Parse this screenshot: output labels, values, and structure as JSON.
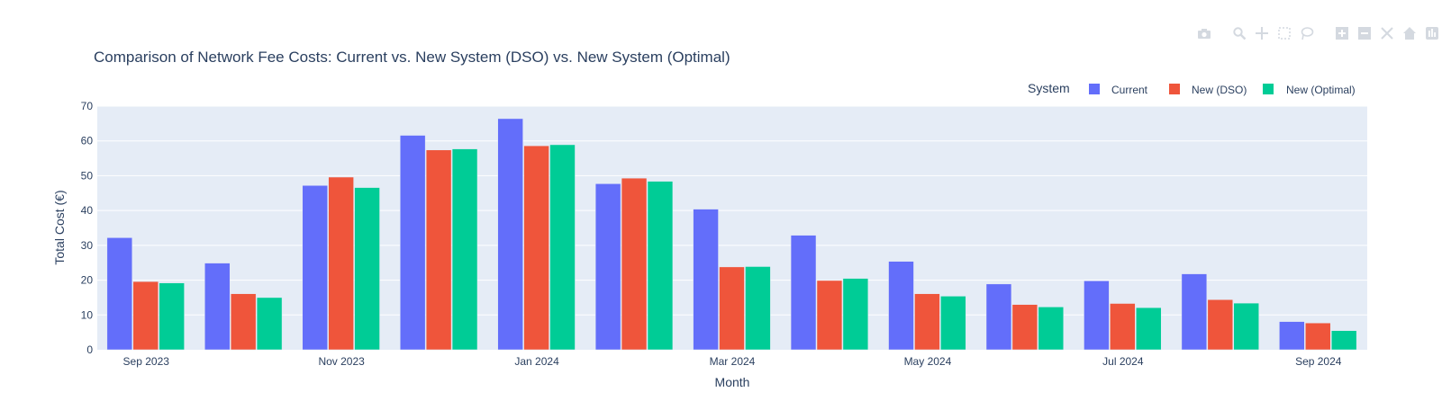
{
  "toolbar": {
    "buttons": [
      {
        "icon": "camera-icon",
        "label": "Download plot as a png"
      },
      {
        "icon": "zoom-icon",
        "label": "Zoom"
      },
      {
        "icon": "pan-icon",
        "label": "Pan"
      },
      {
        "icon": "box-select-icon",
        "label": "Box Select"
      },
      {
        "icon": "lasso-select-icon",
        "label": "Lasso Select"
      },
      {
        "icon": "zoom-in-icon",
        "label": "Zoom in"
      },
      {
        "icon": "zoom-out-icon",
        "label": "Zoom out"
      },
      {
        "icon": "autoscale-icon",
        "label": "Autoscale"
      },
      {
        "icon": "home-icon",
        "label": "Reset axes"
      },
      {
        "icon": "plotly-logo-icon",
        "label": "Produced with Plotly"
      }
    ]
  },
  "chart_data": {
    "type": "bar",
    "title": "Comparison of Network Fee Costs: Current vs. New System (DSO) vs. New System (Optimal)",
    "xlabel": "Month",
    "ylabel": "Total Cost (€)",
    "ylim": [
      0,
      70
    ],
    "yticks": [
      "0",
      "10",
      "20",
      "30",
      "40",
      "50",
      "60",
      "70"
    ],
    "xticks": [
      "Sep 2023",
      "Nov 2023",
      "Jan 2024",
      "Mar 2024",
      "May 2024",
      "Jul 2024",
      "Sep 2024"
    ],
    "categories": [
      "2023-09",
      "2023-10",
      "2023-11",
      "2023-12",
      "2024-01",
      "2024-02",
      "2024-03",
      "2024-04",
      "2024-05",
      "2024-06",
      "2024-07",
      "2024-08",
      "2024-09"
    ],
    "legend_title": "System",
    "legend_position": "top-right",
    "grid": true,
    "series": [
      {
        "name": "Current",
        "color": "#636efa",
        "values": [
          32.2,
          24.9,
          47.2,
          61.6,
          66.4,
          47.7,
          40.4,
          32.9,
          25.4,
          18.9,
          19.8,
          21.8,
          8.1
        ]
      },
      {
        "name": "New (DSO)",
        "color": "#ef553b",
        "values": [
          19.6,
          16.1,
          49.6,
          57.4,
          58.6,
          49.3,
          23.8,
          19.9,
          16.1,
          13.0,
          13.3,
          14.4,
          7.7
        ]
      },
      {
        "name": "New (Optimal)",
        "color": "#00cc96",
        "values": [
          19.2,
          15.0,
          46.6,
          57.7,
          58.9,
          48.4,
          23.9,
          20.5,
          15.4,
          12.3,
          12.1,
          13.4,
          5.5
        ]
      }
    ]
  }
}
